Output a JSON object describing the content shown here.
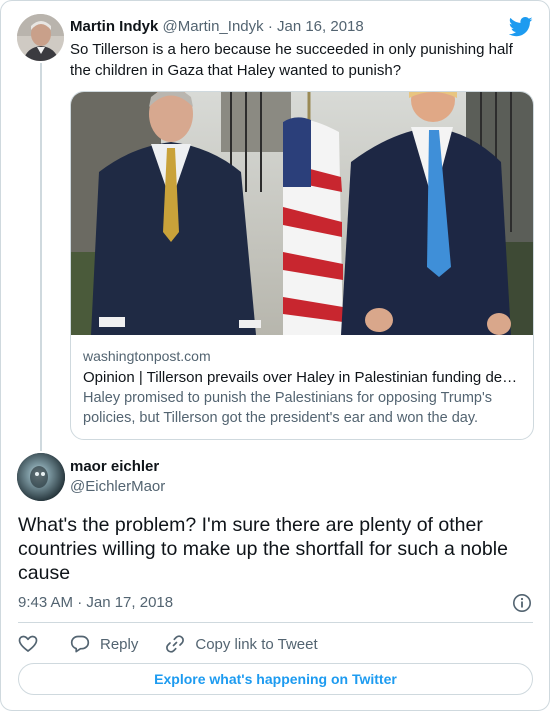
{
  "tweet": {
    "author_name": "Martin Indyk",
    "author_handle": "@Martin_Indyk",
    "separator": "·",
    "date": "Jan 16, 2018",
    "text": "So Tillerson is a hero because he succeeded in only punishing half the children in Gaza that Haley wanted to punish?",
    "link_card": {
      "domain": "washingtonpost.com",
      "title": "Opinion | Tillerson prevails over Haley in Palestinian funding de…",
      "description": "Haley promised to punish the Palestinians for opposing Trump's policies, but Tillerson got the president's ear and won the day."
    }
  },
  "reply": {
    "author_name": "maor eichler",
    "author_handle": "@EichlerMaor",
    "text": "What's the problem? I'm sure there are plenty of other countries willing to make up the shortfall for such a noble cause",
    "timestamp": "9:43 AM · Jan 17, 2018"
  },
  "actions": {
    "reply_label": "Reply",
    "copy_label": "Copy link to Tweet"
  },
  "explore_label": "Explore what's happening on Twitter",
  "icons": {
    "brand": "twitter-bird-icon",
    "like": "heart-icon",
    "reply": "comment-icon",
    "copy": "link-icon",
    "info": "info-icon"
  },
  "colors": {
    "accent": "#1d9bf0",
    "text": "#0f1419",
    "muted": "#536471",
    "border": "#cfd9de"
  }
}
